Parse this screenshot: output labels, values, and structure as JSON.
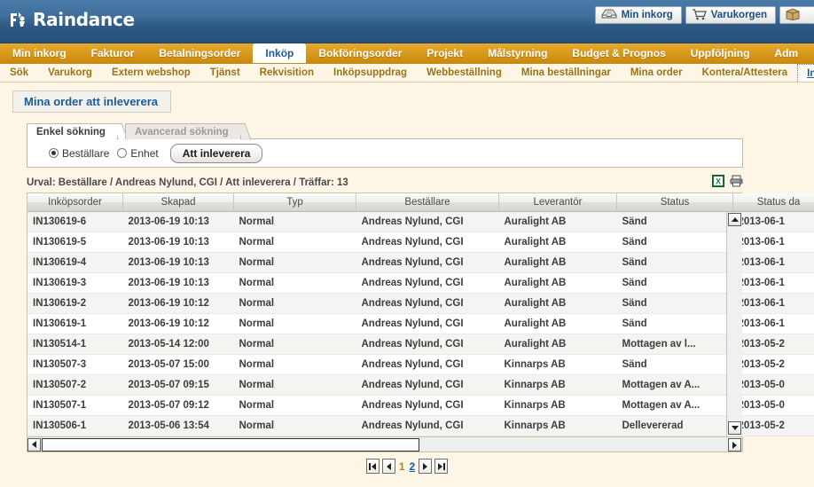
{
  "header": {
    "logo_text": "Raindance",
    "logo_icon": "raindance-logo-icon",
    "buttons": [
      {
        "label": "Min inkorg",
        "icon": "inbox-tray-icon"
      },
      {
        "label": "Varukorgen",
        "icon": "shopping-cart-icon"
      },
      {
        "label": "",
        "icon": "package-box-icon"
      }
    ]
  },
  "main_nav": {
    "items": [
      {
        "label": "Min inkorg",
        "active": false
      },
      {
        "label": "Fakturor",
        "active": false
      },
      {
        "label": "Betalningsorder",
        "active": false
      },
      {
        "label": "Inköp",
        "active": true
      },
      {
        "label": "Bokföringsorder",
        "active": false
      },
      {
        "label": "Projekt",
        "active": false
      },
      {
        "label": "Målstyrning",
        "active": false
      },
      {
        "label": "Budget & Prognos",
        "active": false
      },
      {
        "label": "Uppföljning",
        "active": false
      },
      {
        "label": "Adm",
        "active": false
      }
    ]
  },
  "sub_nav": {
    "items": [
      {
        "label": "Sök",
        "active": false
      },
      {
        "label": "Varukorg",
        "active": false
      },
      {
        "label": "Extern webshop",
        "active": false
      },
      {
        "label": "Tjänst",
        "active": false
      },
      {
        "label": "Rekvisition",
        "active": false
      },
      {
        "label": "Inköpsuppdrag",
        "active": false
      },
      {
        "label": "Webbeställning",
        "active": false
      },
      {
        "label": "Mina beställningar",
        "active": false
      },
      {
        "label": "Mina order",
        "active": false
      },
      {
        "label": "Kontera/Attestera",
        "active": false
      },
      {
        "label": "Inleverans",
        "active": true
      }
    ]
  },
  "page_title": "Mina order att inleverera",
  "search_panel": {
    "tabs": [
      {
        "label": "Enkel sökning",
        "active": true
      },
      {
        "label": "Avancerad sökning",
        "active": false
      }
    ],
    "radio_bestallare": "Beställare",
    "radio_enhet": "Enhet",
    "radio_selected": "Beställare",
    "action_button": "Att inleverera"
  },
  "selection_line": {
    "text": "Urval: Beställare / Andreas Nylund, CGI / Att inleverera / Träffar: 13",
    "excel_icon": "excel-export-icon",
    "print_icon": "printer-icon"
  },
  "grid": {
    "columns": [
      "Inköpsorder",
      "Skapad",
      "Typ",
      "Beställare",
      "Leverantör",
      "Status",
      "Status da"
    ],
    "rows": [
      {
        "order": "IN130619-6",
        "skapad": "2013-06-19 10:13",
        "typ": "Normal",
        "bestallare": "Andreas Nylund, CGI",
        "leverantor": "Auralight AB",
        "status": "Sänd",
        "statusdat": "2013-06-1"
      },
      {
        "order": "IN130619-5",
        "skapad": "2013-06-19 10:13",
        "typ": "Normal",
        "bestallare": "Andreas Nylund, CGI",
        "leverantor": "Auralight AB",
        "status": "Sänd",
        "statusdat": "2013-06-1"
      },
      {
        "order": "IN130619-4",
        "skapad": "2013-06-19 10:13",
        "typ": "Normal",
        "bestallare": "Andreas Nylund, CGI",
        "leverantor": "Auralight AB",
        "status": "Sänd",
        "statusdat": "2013-06-1"
      },
      {
        "order": "IN130619-3",
        "skapad": "2013-06-19 10:13",
        "typ": "Normal",
        "bestallare": "Andreas Nylund, CGI",
        "leverantor": "Auralight AB",
        "status": "Sänd",
        "statusdat": "2013-06-1"
      },
      {
        "order": "IN130619-2",
        "skapad": "2013-06-19 10:12",
        "typ": "Normal",
        "bestallare": "Andreas Nylund, CGI",
        "leverantor": "Auralight AB",
        "status": "Sänd",
        "statusdat": "2013-06-1"
      },
      {
        "order": "IN130619-1",
        "skapad": "2013-06-19 10:12",
        "typ": "Normal",
        "bestallare": "Andreas Nylund, CGI",
        "leverantor": "Auralight AB",
        "status": "Sänd",
        "statusdat": "2013-06-1"
      },
      {
        "order": "IN130514-1",
        "skapad": "2013-05-14 12:00",
        "typ": "Normal",
        "bestallare": "Andreas Nylund, CGI",
        "leverantor": "Auralight AB",
        "status": "Mottagen av l...",
        "statusdat": "2013-05-2"
      },
      {
        "order": "IN130507-3",
        "skapad": "2013-05-07 15:00",
        "typ": "Normal",
        "bestallare": "Andreas Nylund, CGI",
        "leverantor": "Kinnarps AB",
        "status": "Sänd",
        "statusdat": "2013-05-2"
      },
      {
        "order": "IN130507-2",
        "skapad": "2013-05-07 09:15",
        "typ": "Normal",
        "bestallare": "Andreas Nylund, CGI",
        "leverantor": "Kinnarps AB",
        "status": "Mottagen av A...",
        "statusdat": "2013-05-0"
      },
      {
        "order": "IN130507-1",
        "skapad": "2013-05-07 09:12",
        "typ": "Normal",
        "bestallare": "Andreas Nylund, CGI",
        "leverantor": "Kinnarps AB",
        "status": "Mottagen av A...",
        "statusdat": "2013-05-0"
      },
      {
        "order": "IN130506-1",
        "skapad": "2013-05-06 13:54",
        "typ": "Normal",
        "bestallare": "Andreas Nylund, CGI",
        "leverantor": "Kinnarps AB",
        "status": "Dellevererad",
        "statusdat": "2013-05-2"
      }
    ]
  },
  "pager": {
    "first_icon": "first-page-icon",
    "prev_icon": "previous-page-icon",
    "next_icon": "next-page-icon",
    "last_icon": "last-page-icon",
    "pages": [
      {
        "label": "1",
        "current": true
      },
      {
        "label": "2",
        "current": false
      }
    ]
  },
  "colors": {
    "header_blue": "#2e5a85",
    "nav_gold": "#d99a1d",
    "link_blue": "#1d5c96",
    "page_bg": "#fdf6e7",
    "current_page": "#b8860b"
  }
}
